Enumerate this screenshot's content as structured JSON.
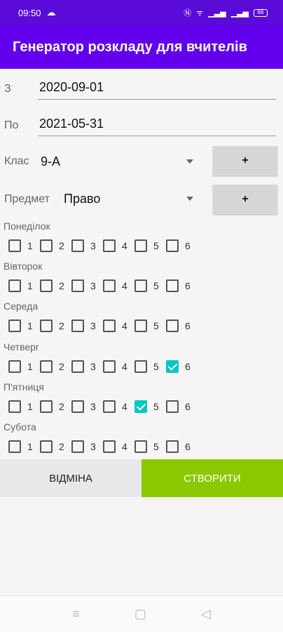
{
  "status_bar": {
    "time": "09:50",
    "battery": "66"
  },
  "app_bar": {
    "title": "Генератор розкладу для вчителів"
  },
  "form": {
    "from_label": "З",
    "from_value": "2020-09-01",
    "to_label": "По",
    "to_value": "2021-05-31",
    "class_label": "Клас",
    "class_value": "9-А",
    "subject_label": "Предмет",
    "subject_value": "Право",
    "add_label": "+"
  },
  "days": [
    {
      "name": "Понеділок",
      "lessons": [
        "1",
        "2",
        "3",
        "4",
        "5",
        "6"
      ],
      "checked": []
    },
    {
      "name": "Вівторок",
      "lessons": [
        "1",
        "2",
        "3",
        "4",
        "5",
        "6"
      ],
      "checked": []
    },
    {
      "name": "Середа",
      "lessons": [
        "1",
        "2",
        "3",
        "4",
        "5",
        "6"
      ],
      "checked": []
    },
    {
      "name": "Четверг",
      "lessons": [
        "1",
        "2",
        "3",
        "4",
        "5",
        "6"
      ],
      "checked": [
        6
      ]
    },
    {
      "name": "П'ятниця",
      "lessons": [
        "1",
        "2",
        "3",
        "4",
        "5",
        "6"
      ],
      "checked": [
        5
      ]
    },
    {
      "name": "Субота",
      "lessons": [
        "1",
        "2",
        "3",
        "4",
        "5",
        "6"
      ],
      "checked": []
    }
  ],
  "actions": {
    "cancel_label": "ВІДМІНА",
    "create_label": "СТВОРИТИ"
  },
  "nav": {
    "menu_icon": "≡",
    "home_icon": "▢",
    "back_icon": "◁"
  },
  "colors": {
    "primary": "#6200ee",
    "status": "#5b0bd8",
    "accent_check": "#03c6c6",
    "create_button": "#8cc800"
  }
}
